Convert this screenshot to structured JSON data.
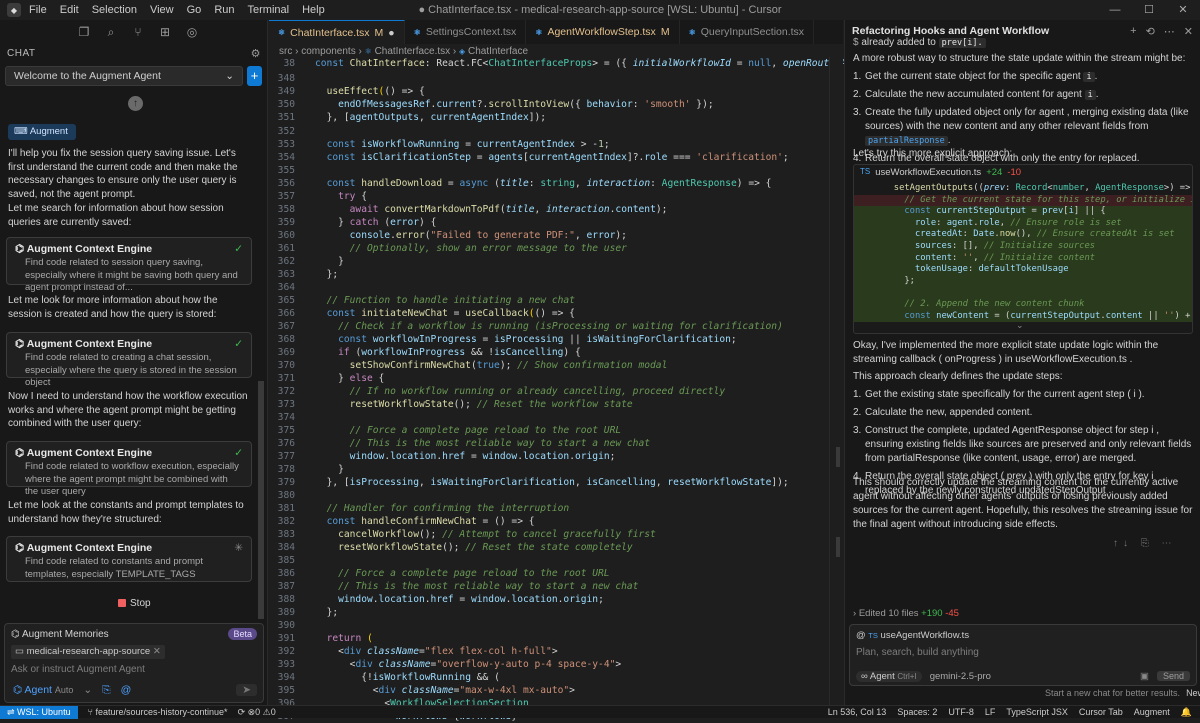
{
  "window": {
    "title": "● ChatInterface.tsx - medical-research-app-source [WSL: Ubuntu] - Cursor",
    "menu": [
      "File",
      "Edit",
      "Selection",
      "View",
      "Go",
      "Run",
      "Terminal",
      "Help"
    ]
  },
  "left_panel": {
    "header": "CHAT",
    "thread_select": "Welcome to the Augment Agent",
    "augment_badge": "Augment",
    "messages": [
      "I'll help you fix the session query saving issue. Let's first understand the current code and then make the necessary changes to ensure only the user query is saved, not the agent prompt.",
      "Let me search for information about how session queries are currently saved:",
      "Let me look for more information about how the session is created and how the query is stored:",
      "Now I need to understand how the workflow execution works and where the agent prompt might be getting combined with the user query:",
      "Let me look at the constants and prompt templates to understand how they're structured:"
    ],
    "tools": [
      {
        "title": "Augment Context Engine",
        "desc": "Find code related to session query saving, especially where it might be saving both query and agent prompt instead of..."
      },
      {
        "title": "Augment Context Engine",
        "desc": "Find code related to creating a chat session, especially where the query is stored in the session object"
      },
      {
        "title": "Augment Context Engine",
        "desc": "Find code related to workflow execution, especially where the agent prompt might be combined with the user query"
      },
      {
        "title": "Augment Context Engine",
        "desc": "Find code related to constants and prompt templates, especially TEMPLATE_TAGS"
      }
    ],
    "stop_label": "Stop",
    "memories_label": "Augment Memories",
    "beta_label": "Beta",
    "context_chip": "medical-research-app-source",
    "input_placeholder": "Ask or instruct Augment Agent",
    "mode_label": "Agent",
    "mode_sub": "Auto"
  },
  "editor": {
    "tabs": [
      {
        "label": "ChatInterface.tsx",
        "flag": "M",
        "active": true
      },
      {
        "label": "SettingsContext.tsx",
        "flag": "",
        "active": false
      },
      {
        "label": "AgentWorkflowStep.tsx",
        "flag": "M",
        "active": false
      },
      {
        "label": "QueryInputSection.tsx",
        "flag": "",
        "active": false
      }
    ],
    "breadcrumb": [
      "src",
      "components",
      "ChatInterface.tsx",
      "ChatInterface"
    ],
    "line_numbers": [
      "38",
      "348",
      "349",
      "350",
      "351",
      "352",
      "353",
      "354",
      "355",
      "356",
      "357",
      "358",
      "359",
      "360",
      "361",
      "362",
      "363",
      "364",
      "365",
      "366",
      "367",
      "368",
      "369",
      "370",
      "371",
      "372",
      "373",
      "374",
      "375",
      "376",
      "377",
      "378",
      "379",
      "380",
      "381",
      "382",
      "383",
      "384",
      "385",
      "386",
      "387",
      "388",
      "389",
      "390",
      "391",
      "392",
      "393",
      "394",
      "395",
      "396",
      "397",
      "398",
      "399"
    ]
  },
  "right_panel": {
    "title": "Refactoring Hooks and Agent Workflow",
    "top_fragment": "already added to",
    "top_fragment_code": "prev[i].",
    "intro": "A more robust way to structure the state update within the stream might be:",
    "steps1": [
      "Get the current state object for the specific agent",
      "Calculate the new accumulated content for agent",
      "Create the fully updated object only for agent , merging existing data (like sources) with the new content and any other relevant fields from",
      "Return the overall state object with only the entry for  replaced."
    ],
    "lets_try": "Let's try this more explicit approach:",
    "diff": {
      "file": "useWorkflowExecution.ts",
      "plus": "+24",
      "minus": "-10"
    },
    "summary": "Okay, I've implemented the more explicit state update logic within the streaming callback ( onProgress ) in useWorkflowExecution.ts .",
    "approach": "This approach clearly defines the update steps:",
    "steps2": [
      "Get the existing state specifically for the current agent step ( i ).",
      "Calculate the new, appended content.",
      "Construct the complete, updated AgentResponse object for step i , ensuring existing fields like sources are preserved and only relevant fields from partialResponse (like content, usage, error) are merged.",
      "Return the overall state object ( prev ) with only the entry for key i replaced by the newly constructed updatedStepOutput ."
    ],
    "conclusion": "This should correctly update the streaming content for the currently active agent without affecting other agents' outputs or losing previously added sources for the current agent. Hopefully, this resolves the streaming issue for the final agent without introducing side effects.",
    "edited": {
      "label": "Edited 10 files",
      "plus": "+190",
      "minus": "-45"
    },
    "compose_file": "useAgentWorkflow.ts",
    "compose_placeholder": "Plan, search, build anything",
    "compose_mode": "Agent",
    "compose_mode_key": "Ctrl+I",
    "compose_model": "gemini-2.5-pro",
    "compose_send": "Send",
    "footer_hint": "Start a new chat for better results.",
    "footer_new": "New chat"
  },
  "status_bar": {
    "remote": "WSL: Ubuntu",
    "branch": "feature/sources-history-continue*",
    "position": "Ln 536, Col 13",
    "spaces": "Spaces: 2",
    "encoding": "UTF-8",
    "eol": "LF",
    "language": "TypeScript JSX",
    "tab": "Cursor Tab",
    "extension": "Augment"
  }
}
